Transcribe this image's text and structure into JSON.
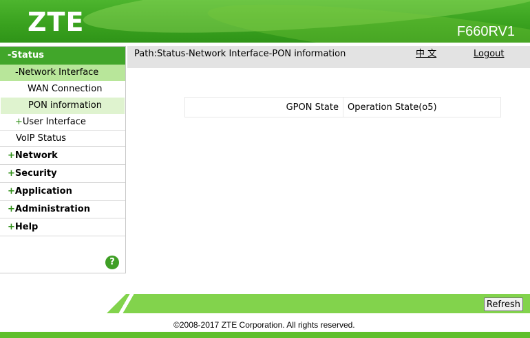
{
  "header": {
    "logo": "ZTE",
    "model": "F660RV1"
  },
  "sidebar": {
    "status": {
      "label": "-Status"
    },
    "network_interface": {
      "label": "-Network Interface"
    },
    "wan_connection": {
      "label": "WAN Connection"
    },
    "pon_information": {
      "label": "PON information"
    },
    "user_interface": {
      "prefix": "+",
      "label": "User Interface"
    },
    "voip_status": {
      "label": "VoIP Status"
    },
    "network": {
      "prefix": "+",
      "label": "Network"
    },
    "security": {
      "prefix": "+",
      "label": "Security"
    },
    "application": {
      "prefix": "+",
      "label": "Application"
    },
    "administration": {
      "prefix": "+",
      "label": "Administration"
    },
    "help": {
      "prefix": "+",
      "label": "Help"
    },
    "help_icon": "?"
  },
  "pathbar": {
    "path": "Path:Status-Network Interface-PON information",
    "language": "中 文",
    "logout": "Logout"
  },
  "pon_table": {
    "rows": [
      {
        "label": "GPON State",
        "value": "Operation State(o5)"
      }
    ]
  },
  "footer": {
    "refresh": "Refresh",
    "copyright": "©2008-2017 ZTE Corporation. All rights reserved."
  },
  "colors": {
    "brand_green": "#41a62a",
    "active_sub": "#b8e69a",
    "footer_green": "#82d34c"
  }
}
